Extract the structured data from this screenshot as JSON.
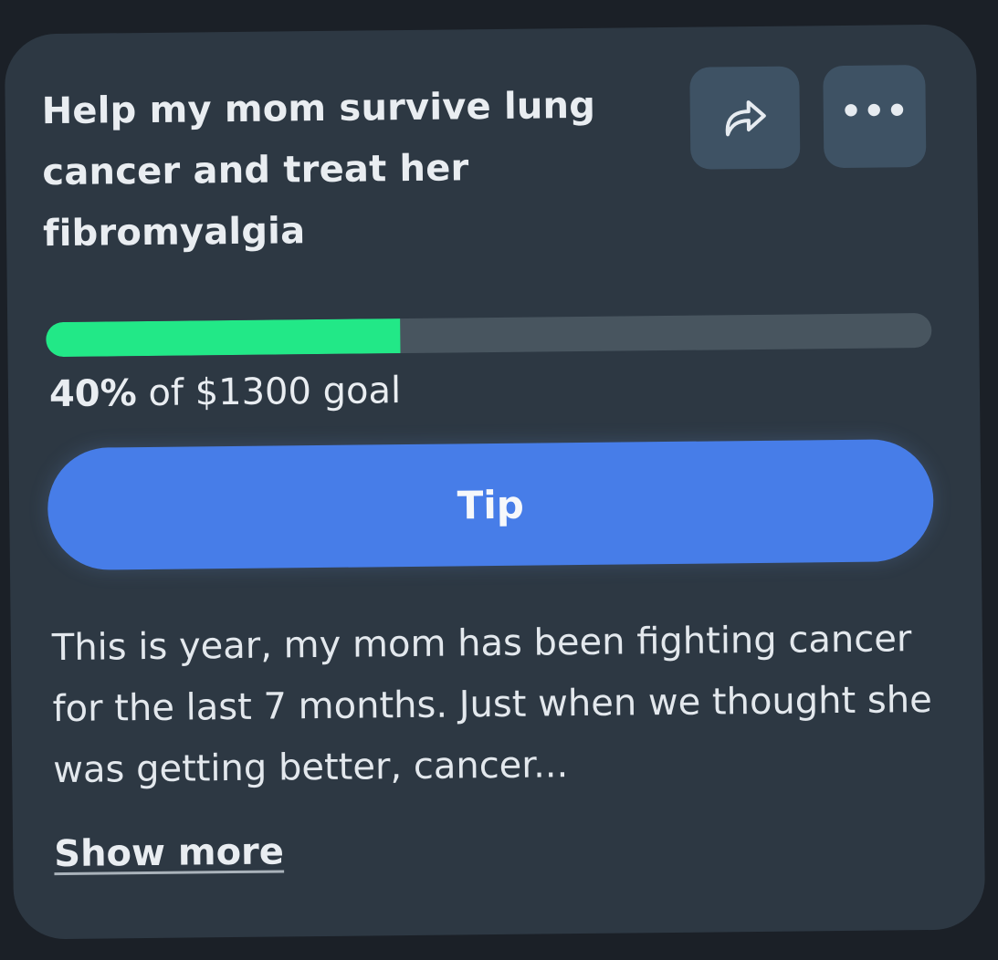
{
  "card": {
    "title": "Help my mom survive lung cancer and treat her fibromyalgia",
    "actions": {
      "share_icon": "share-arrow-icon",
      "more_icon": "more-horizontal-icon",
      "more_glyph": "•••"
    },
    "progress": {
      "fraction": 0.4,
      "percent_label": "40%",
      "goal_text": " of $1300 goal",
      "fill_color": "#22e887",
      "track_color": "#48555f"
    },
    "tip_button": {
      "label": "Tip",
      "color": "#477de8"
    },
    "description": "This is year, my mom has been fighting cancer for the last 7 months. Just when we thought she was getting better, cancer...",
    "show_more_label": "Show more"
  },
  "colors": {
    "background": "#1b2027",
    "card": "#2d3843",
    "icon_button": "#3e5264",
    "text": "#e9edf1"
  }
}
